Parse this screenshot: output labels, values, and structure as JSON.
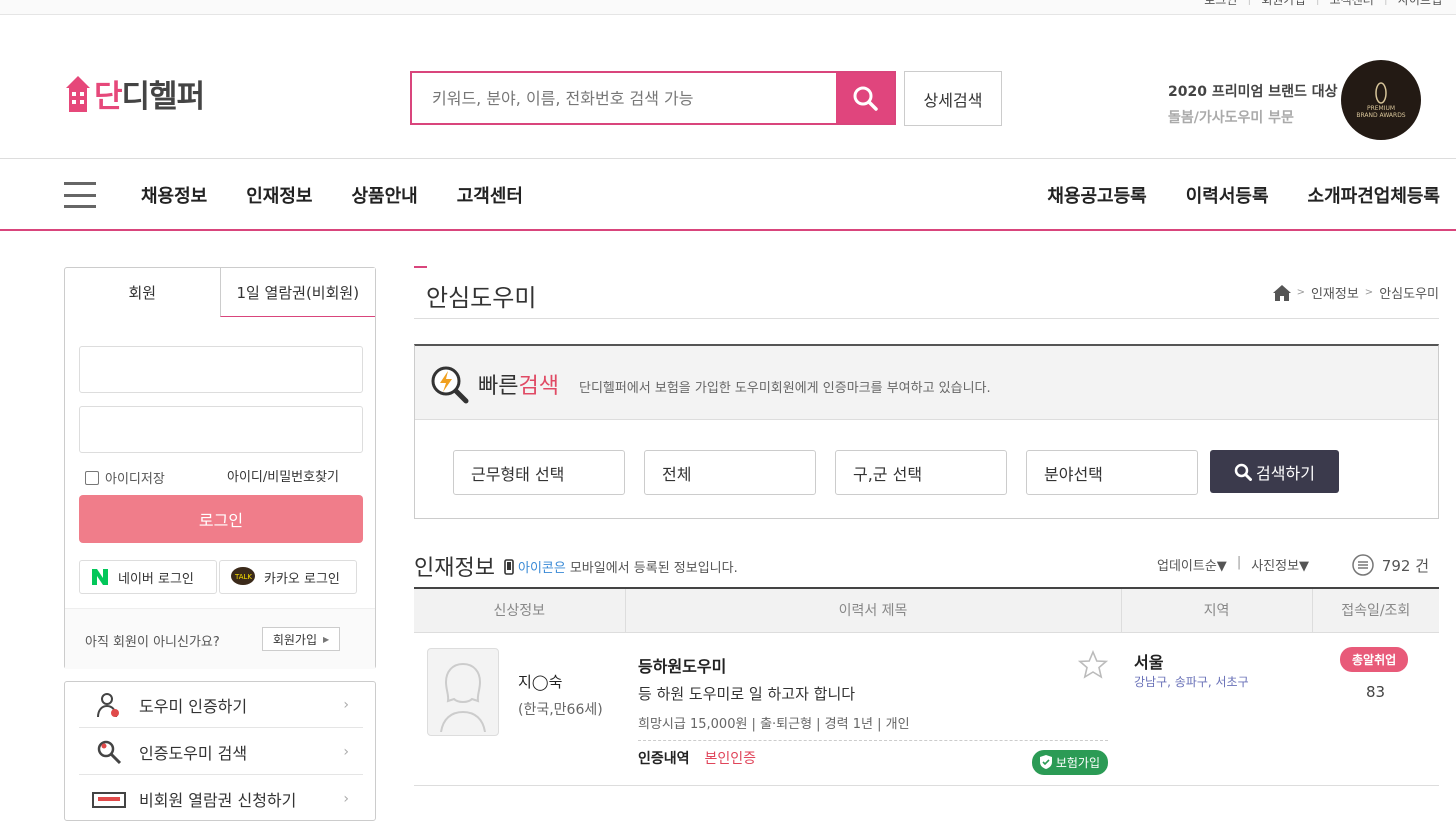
{
  "topbar": {
    "links": [
      "로그인",
      "회원가입",
      "고객센터",
      "사이트맵"
    ]
  },
  "logo": {
    "first": "단",
    "rest": "디헬퍼"
  },
  "search": {
    "placeholder": "키워드, 분야, 이름, 전화번호 검색 가능",
    "detail": "상세검색"
  },
  "award": {
    "line1": "2020 프리미엄 브랜드 대상",
    "line2": "돌봄/가사도우미 부문",
    "badge": "PREMIUM BRAND AWARDS"
  },
  "nav": {
    "left": [
      "채용정보",
      "인재정보",
      "상품안내",
      "고객센터"
    ],
    "right": [
      "채용공고등록",
      "이력서등록",
      "소개파견업체등록"
    ]
  },
  "login": {
    "tab_member": "회원",
    "tab_guest": "1일 열람권(비회원)",
    "remember": "아이디저장",
    "find": "아이디/비밀번호찾기",
    "login_btn": "로그인",
    "naver": "네이버 로그인",
    "kakao": "카카오 로그인",
    "not_member": "아직 회원이 아니신가요?",
    "join": "회원가입"
  },
  "side_menu": [
    "도우미 인증하기",
    "인증도우미 검색",
    "비회원 열람권 신청하기"
  ],
  "page": {
    "title": "안심도우미",
    "crumb1": "인재정보",
    "crumb2": "안심도우미"
  },
  "quick": {
    "t1": "빠른",
    "t2": "검색",
    "desc": "단디헬퍼에서 보험을 가입한 도우미회원에게 인증마크를 부여하고 있습니다.",
    "sel1": "근무형태 선택",
    "sel2": "전체",
    "sel3": "구,군 선택",
    "sel4": "분야선택",
    "go": "검색하기"
  },
  "list": {
    "title": "인재정보",
    "icon_word": "아이콘은",
    "sub": "모바일에서 등록된 정보입니다.",
    "sort1": "업데이트순▼",
    "sort2": "사진정보▼",
    "count": "792 건",
    "headers": [
      "신상정보",
      "이력서 제목",
      "지역",
      "접속일/조회"
    ]
  },
  "row": {
    "name": "지◯숙",
    "age": "(한국,만66세)",
    "title": "등하원도우미",
    "desc": "등 하원 도우미로 일 하고자 합니다",
    "info": "희망시급 15,000원 | 출·퇴근형 | 경력 1년 | 개인",
    "cert_label": "인증내역",
    "cert_value": "본인인증",
    "insurance": "보험가입",
    "city": "서울",
    "districts": "강남구, 송파구, 서초구",
    "badge": "총알취업",
    "views": "83"
  },
  "colors": {
    "brand": "#e0457d",
    "login": "#f07d8a",
    "dark_btn": "#3b3a4c",
    "green": "#2b9b55"
  }
}
